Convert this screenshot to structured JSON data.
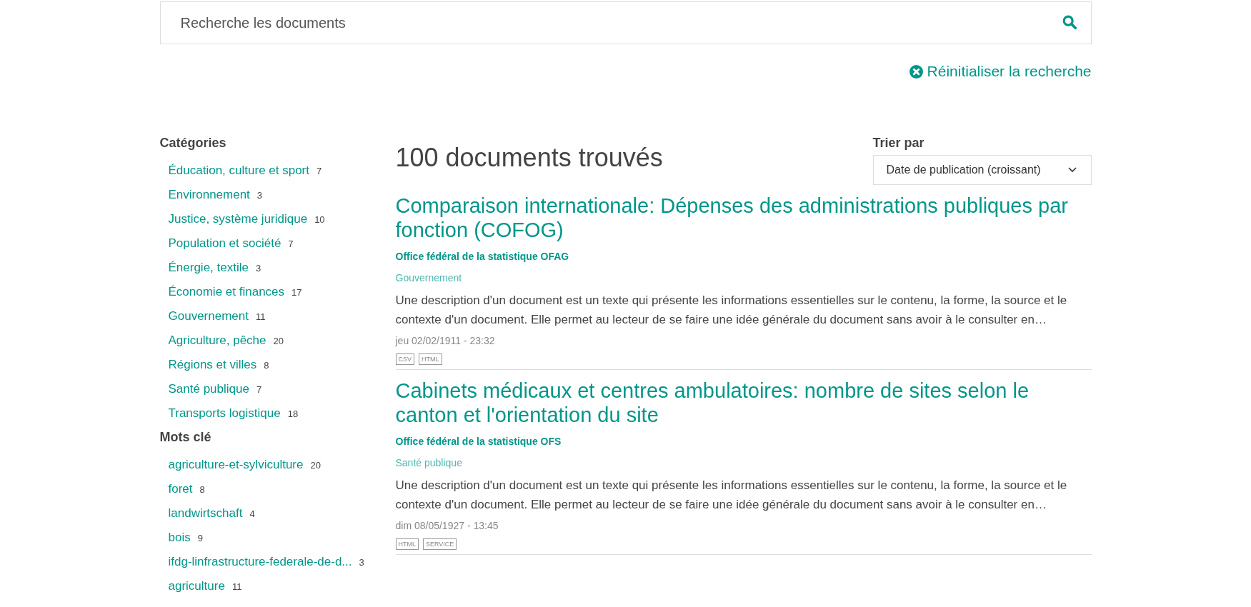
{
  "search": {
    "placeholder": "Recherche les documents"
  },
  "reset_link": "Réinitialiser la recherche",
  "sidebar": [
    {
      "heading": "Catégories",
      "items": [
        {
          "label": "Éducation, culture et sport",
          "count": "7"
        },
        {
          "label": "Environnement",
          "count": "3"
        },
        {
          "label": "Justice, système juridique",
          "count": "10"
        },
        {
          "label": "Population et société",
          "count": "7"
        },
        {
          "label": "Énergie, textile",
          "count": "3"
        },
        {
          "label": "Économie et finances",
          "count": "17"
        },
        {
          "label": "Gouvernement",
          "count": "11"
        },
        {
          "label": "Agriculture, pêche",
          "count": "20"
        },
        {
          "label": "Régions et villes",
          "count": "8"
        },
        {
          "label": "Santé publique",
          "count": "7"
        },
        {
          "label": "Transports logistique",
          "count": "18"
        }
      ]
    },
    {
      "heading": "Mots clé",
      "items": [
        {
          "label": "agriculture-et-sylviculture",
          "count": "20"
        },
        {
          "label": "foret",
          "count": "8"
        },
        {
          "label": "landwirtschaft",
          "count": "4"
        },
        {
          "label": "bois",
          "count": "9"
        },
        {
          "label": "ifdg-linfrastructure-federale-de-d...",
          "count": "3"
        },
        {
          "label": "agriculture",
          "count": "11"
        }
      ]
    }
  ],
  "results_title": "100 documents trouvés",
  "sort": {
    "label": "Trier par",
    "value": "Date de publication (croissant)"
  },
  "results": [
    {
      "title": "Comparaison internationale: Dépenses des administrations publiques par fonction (COFOG)",
      "publisher": "Office fédéral de la statistique OFAG",
      "category": "Gouvernement",
      "description": "Une description d'un document est un texte qui présente les informations essentielles sur le contenu, la forme, la source et le contexte d'un document. Elle permet au lecteur de se faire une idée générale du document sans avoir à le consulter en…",
      "date": "jeu 02/02/1911 - 23:32",
      "formats": [
        "CSV",
        "HTML"
      ]
    },
    {
      "title": "Cabinets médicaux et centres ambulatoires: nombre de sites selon le canton et l'orientation du site",
      "publisher": "Office fédéral de la statistique OFS",
      "category": "Santé publique",
      "description": "Une description d'un document est un texte qui présente les informations essentielles sur le contenu, la forme, la source et le contexte d'un document. Elle permet au lecteur de se faire une idée générale du document sans avoir à le consulter en…",
      "date": "dim 08/05/1927 - 13:45",
      "formats": [
        "HTML",
        "SERVICE"
      ]
    }
  ]
}
